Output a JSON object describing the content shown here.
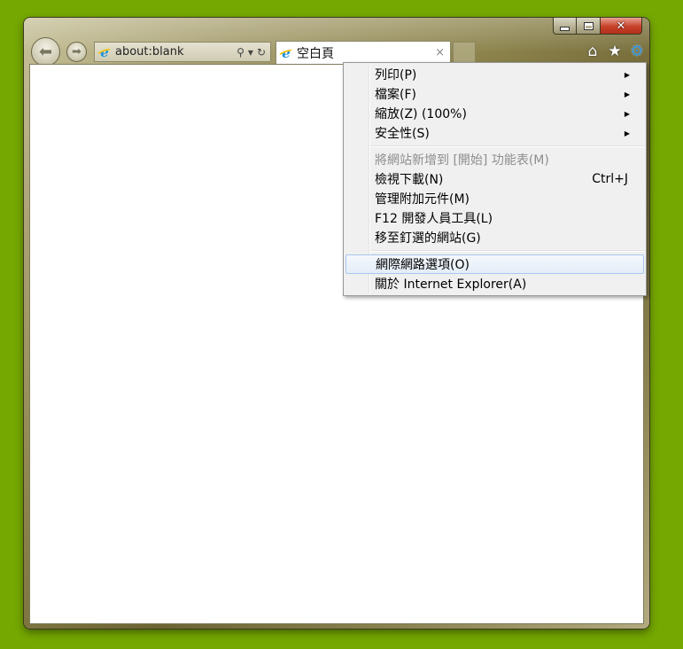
{
  "window": {
    "caption": {
      "minimize_icon": "minimize-icon",
      "maximize_icon": "maximize-icon",
      "close_glyph": "✕"
    },
    "nav": {
      "back_glyph": "⬅",
      "forward_glyph": "➡"
    },
    "address": {
      "value": "about:blank",
      "search_glyph": "⚲",
      "dropdown_glyph": "▾",
      "refresh_glyph": "↻"
    },
    "tab": {
      "label": "空白頁",
      "close_glyph": "×"
    },
    "command_bar": {
      "home_glyph": "⌂",
      "favorites_glyph": "★",
      "tools_glyph": "⚙"
    }
  },
  "tools_menu": {
    "groups": [
      [
        {
          "label": "列印(P)",
          "submenu": true
        },
        {
          "label": "檔案(F)",
          "submenu": true
        },
        {
          "label": "縮放(Z) (100%)",
          "submenu": true
        },
        {
          "label": "安全性(S)",
          "submenu": true
        }
      ],
      [
        {
          "label": "將網站新增到 [開始] 功能表(M)",
          "disabled": true
        },
        {
          "label": "檢視下載(N)",
          "shortcut": "Ctrl+J"
        },
        {
          "label": "管理附加元件(M)"
        },
        {
          "label": "F12 開發人員工具(L)"
        },
        {
          "label": "移至釘選的網站(G)"
        }
      ],
      [
        {
          "label": "網際網路選項(O)",
          "highlighted": true
        },
        {
          "label": "關於 Internet Explorer(A)"
        }
      ]
    ],
    "submenu_arrow": "▶"
  },
  "colors": {
    "desktop": "#75a800",
    "menu_bg": "#f0f0f0",
    "menu_highlight_border": "#a8c7ec",
    "gear_accent": "#2a8bd4"
  }
}
